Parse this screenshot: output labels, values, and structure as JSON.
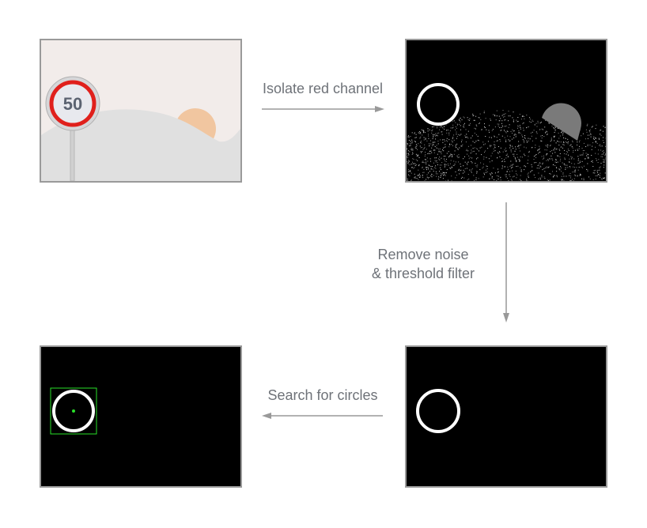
{
  "panels": {
    "original": {
      "sign_text": "50"
    }
  },
  "steps": [
    {
      "lines": [
        "Isolate red channel"
      ]
    },
    {
      "lines": [
        "Remove noise",
        "& threshold filter"
      ]
    },
    {
      "lines": [
        "Search for circles"
      ]
    }
  ],
  "colors": {
    "sign_ring": "#e0201c",
    "sign_face": "#e8e9ee",
    "sign_text": "#5b6371",
    "sun": "#f1c6a0",
    "hill": "#e0e0e0",
    "detection_box": "#29e029",
    "arrow": "#999999"
  }
}
